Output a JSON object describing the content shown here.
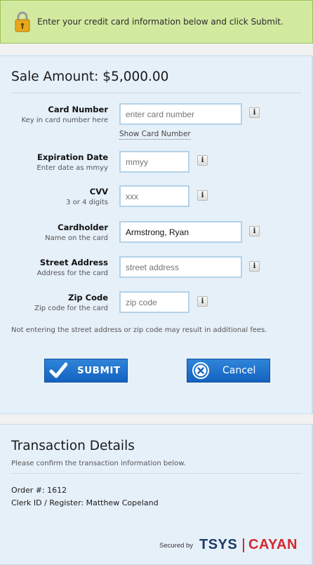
{
  "banner": {
    "icon": "lock-icon",
    "text": "Enter your credit card information below and click Submit."
  },
  "sale": {
    "title": "Sale Amount: $5,000.00"
  },
  "form": {
    "card_number": {
      "label": "Card Number",
      "sub": "Key in card number here",
      "placeholder": "enter card number",
      "value": ""
    },
    "show_card_link": "Show Card Number",
    "expiration": {
      "label": "Expiration Date",
      "sub": "Enter date as mmyy",
      "placeholder": "mmyy",
      "value": ""
    },
    "cvv": {
      "label": "CVV",
      "sub": "3 or 4 digits",
      "placeholder": "xxx",
      "value": ""
    },
    "cardholder": {
      "label": "Cardholder",
      "sub": "Name on the card",
      "placeholder": "",
      "value": "Armstrong, Ryan"
    },
    "street": {
      "label": "Street Address",
      "sub": "Address for the card",
      "placeholder": "street address",
      "value": ""
    },
    "zip": {
      "label": "Zip Code",
      "sub": "Zip code for the card",
      "placeholder": "zip code",
      "value": ""
    },
    "info_glyph": "i",
    "note": "Not entering the street address or zip code may result in additional fees."
  },
  "buttons": {
    "submit_label": "SUBMIT",
    "cancel_label": "Cancel"
  },
  "transaction": {
    "title": "Transaction Details",
    "subtitle": "Please confirm the transaction information below.",
    "order": "Order #: 1612",
    "clerk": "Clerk ID / Register: Matthew Copeland"
  },
  "footer": {
    "secured_by": "Secured by",
    "brand1": "TSYS",
    "brand2": "CAYAN"
  },
  "colors": {
    "banner_bg": "#d2eaa0",
    "panel_bg": "#e6f0f9",
    "button_blue": "#1a6fcc",
    "tsys_navy": "#1b3b67",
    "cayan_red": "#d6272e"
  }
}
